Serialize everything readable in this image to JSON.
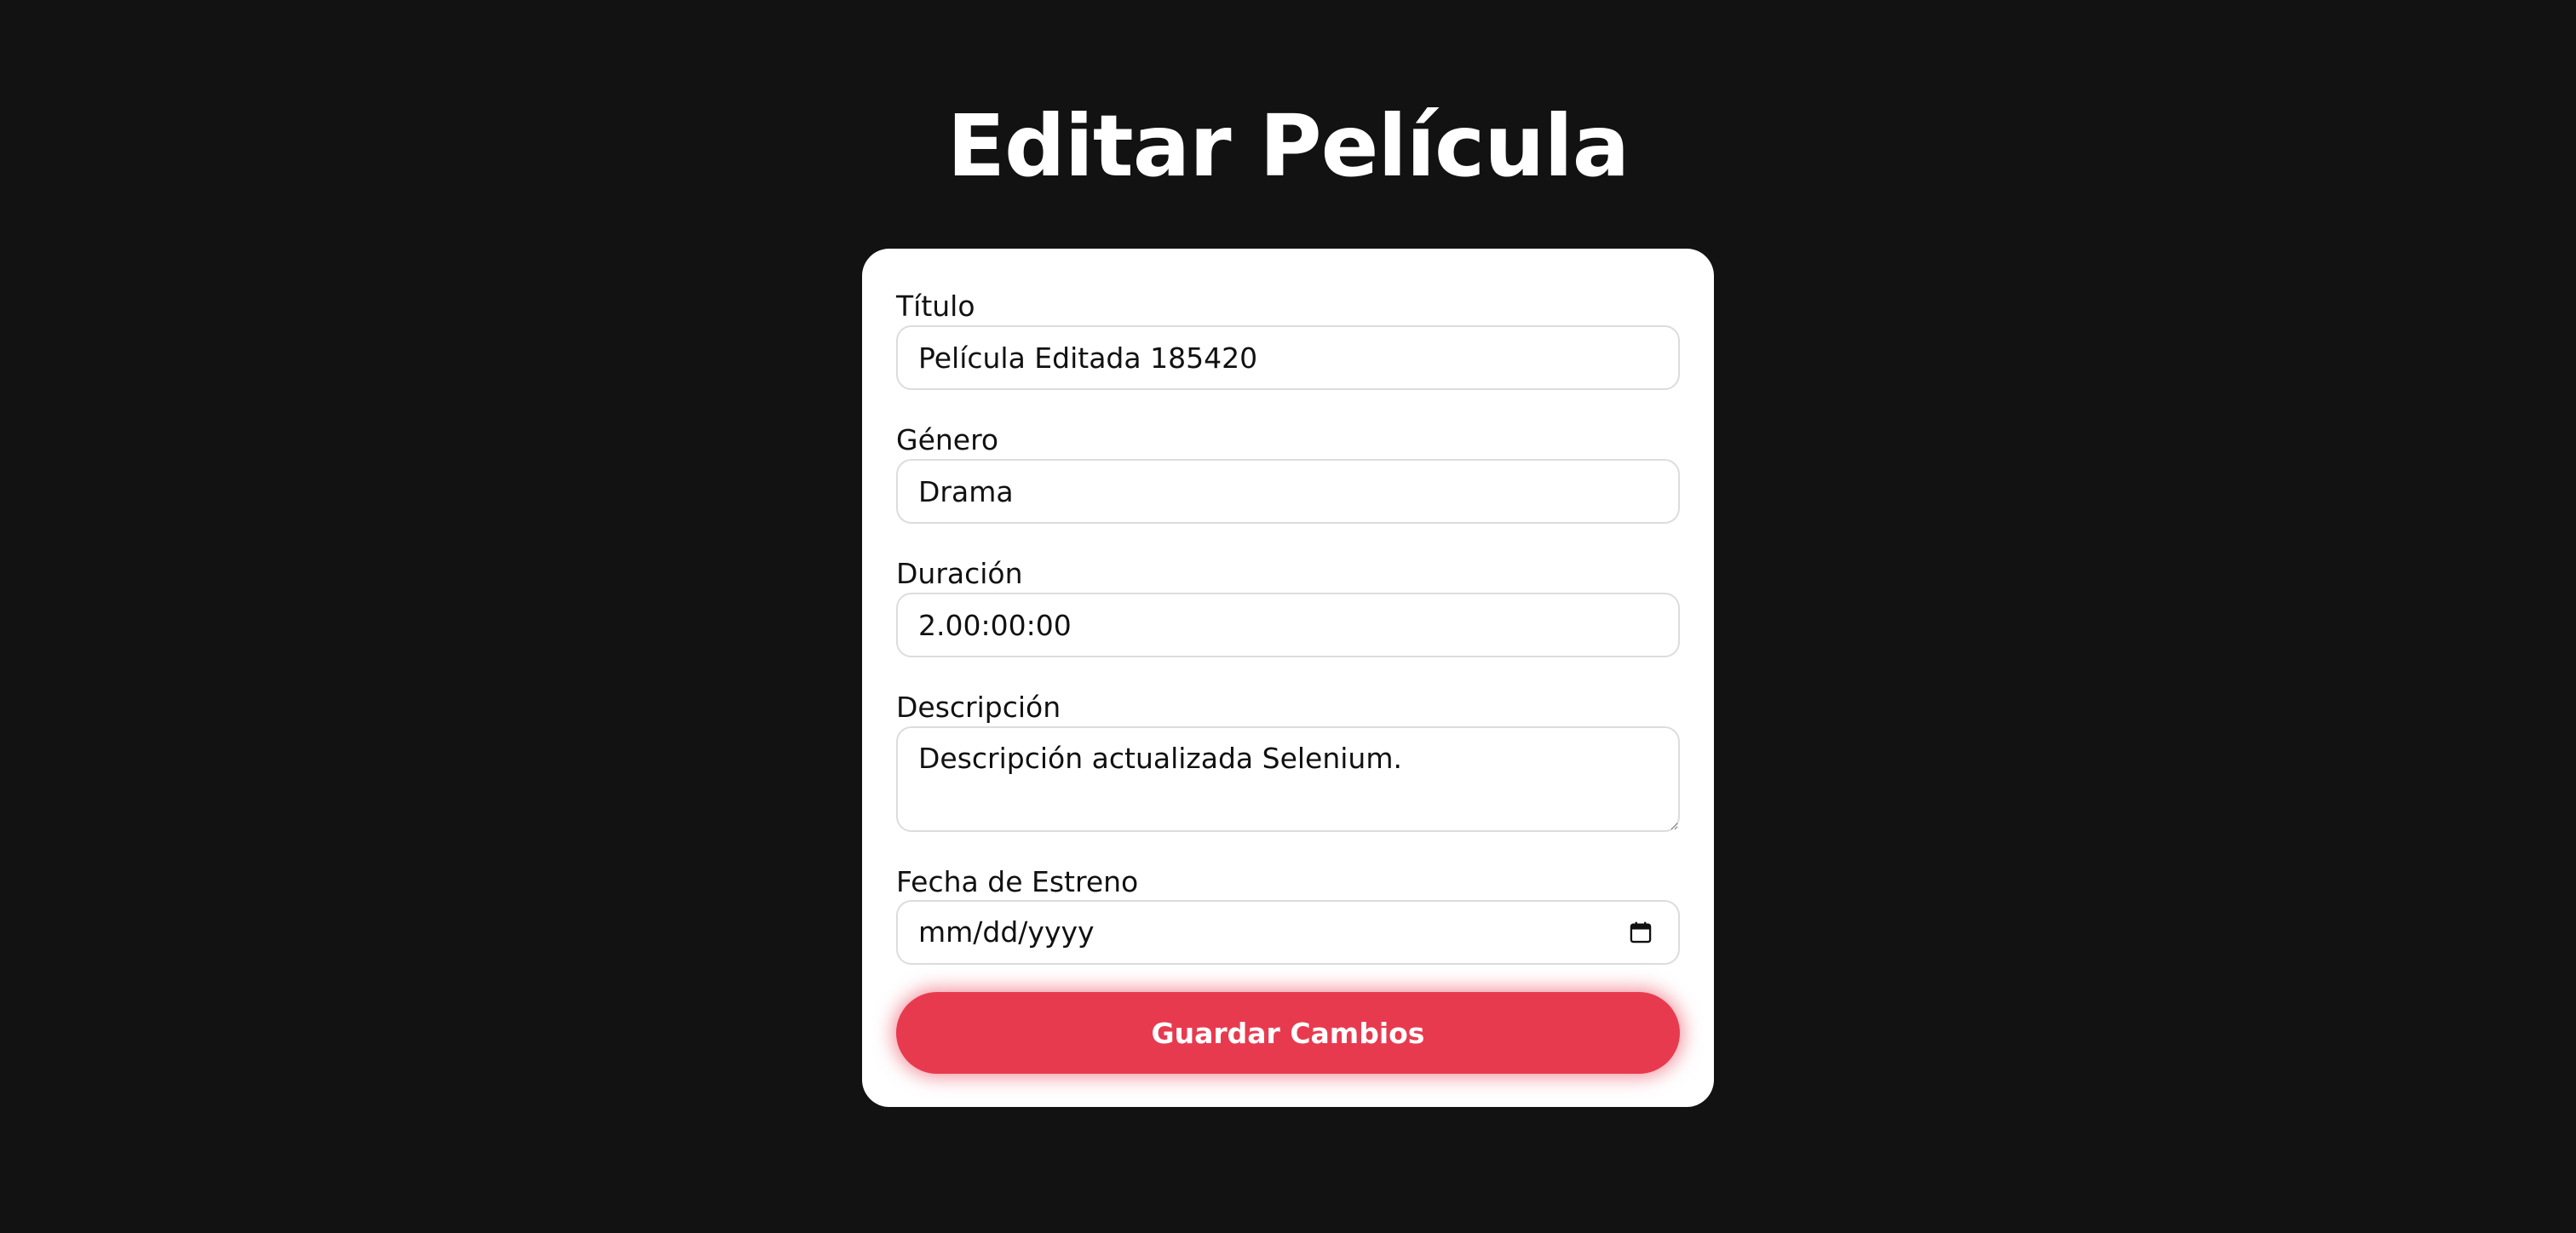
{
  "page": {
    "title": "Editar Película"
  },
  "form": {
    "titulo": {
      "label": "Título",
      "value": "Película Editada 185420"
    },
    "genero": {
      "label": "Género",
      "value": "Drama"
    },
    "duracion": {
      "label": "Duración",
      "value": "2.00:00:00"
    },
    "descripcion": {
      "label": "Descripción",
      "value": "Descripción actualizada Selenium."
    },
    "fecha_estreno": {
      "label": "Fecha de Estreno",
      "placeholder": "mm/dd/yyyy",
      "icon": "calendar-icon"
    },
    "submit_label": "Guardar Cambios"
  },
  "colors": {
    "background": "#121212",
    "card": "#ffffff",
    "accent": "#e83a4e"
  }
}
